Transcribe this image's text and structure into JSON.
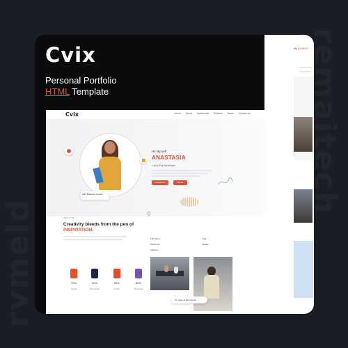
{
  "brand": {
    "name": "Cvix",
    "tagline_line1": "Personal Portfolio",
    "tagline_html": "HTML",
    "tagline_rest": "Template"
  },
  "mock": {
    "logo": "Cvix",
    "nav": [
      "Home",
      "About",
      "Academics",
      "Portfolio",
      "News",
      "Contact Us"
    ],
    "hero": {
      "greeting": "Hi! My self",
      "name": "ANASTASIA",
      "role": "I am a Php Developer",
      "badge": "With Business Growth",
      "btn1": "Download CV",
      "btn2": "Hire Me"
    },
    "about": {
      "eyebrow": "ABOUT ME",
      "heading1": "Creativity bleeds from the pen of",
      "heading2": "INSPIRATION.",
      "skills": [
        {
          "name": "Figma",
          "pct": "70%",
          "color": "#f24e1e"
        },
        {
          "name": "Photoshop",
          "pct": "90%",
          "color": "#1b2a4a"
        },
        {
          "name": "HTML",
          "pct": "95%",
          "color": "#e44d26"
        },
        {
          "name": "Bootstrap",
          "pct": "80%",
          "color": "#7952b3"
        }
      ],
      "info": [
        "Full Name :",
        "Age :",
        "Phone No :",
        "Email :",
        "Address :"
      ],
      "experience": "8+ Years of Experience"
    }
  },
  "side": {
    "title_prefix": "My",
    "title_accent": "ACHIEVE"
  },
  "watermark": [
    "rvmeld",
    "remaitech"
  ]
}
